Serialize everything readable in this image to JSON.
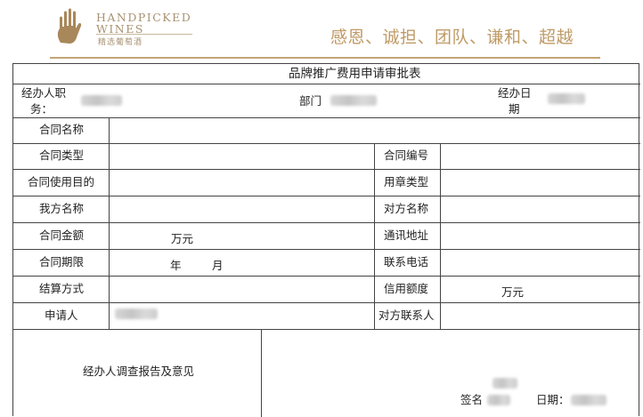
{
  "brand": {
    "name_line1": "HANDPICKED",
    "name_line2": "WINES",
    "name_cn": "精选葡萄酒",
    "slogan": "感恩、诚担、团队、谦和、超越"
  },
  "form": {
    "title": "品牌推广费用申请审批表",
    "handler_label_1": "经办人职",
    "handler_label_2": "务：",
    "dept_label": "部门",
    "date_label_1": "经办日",
    "date_label_2": "期",
    "rows": {
      "contract_name": "合同名称",
      "contract_type": "合同类型",
      "contract_no": "合同编号",
      "contract_purpose": "合同使用目的",
      "seal_type": "用章类型",
      "our_name": "我方名称",
      "counterparty_name": "对方名称",
      "contract_amount": "合同金额",
      "amount_unit": "万元",
      "address": "通讯地址",
      "contract_term": "合同期限",
      "year_label": "年",
      "month_label": "月",
      "phone": "联系电话",
      "settlement": "结算方式",
      "credit_limit": "信用额度",
      "credit_unit": "万元",
      "applicant": "申请人",
      "counterparty_contact": "对方联系人",
      "investigation": "经办人调查报告及意见",
      "signature_label": "签名",
      "date_label": "日期："
    }
  }
}
